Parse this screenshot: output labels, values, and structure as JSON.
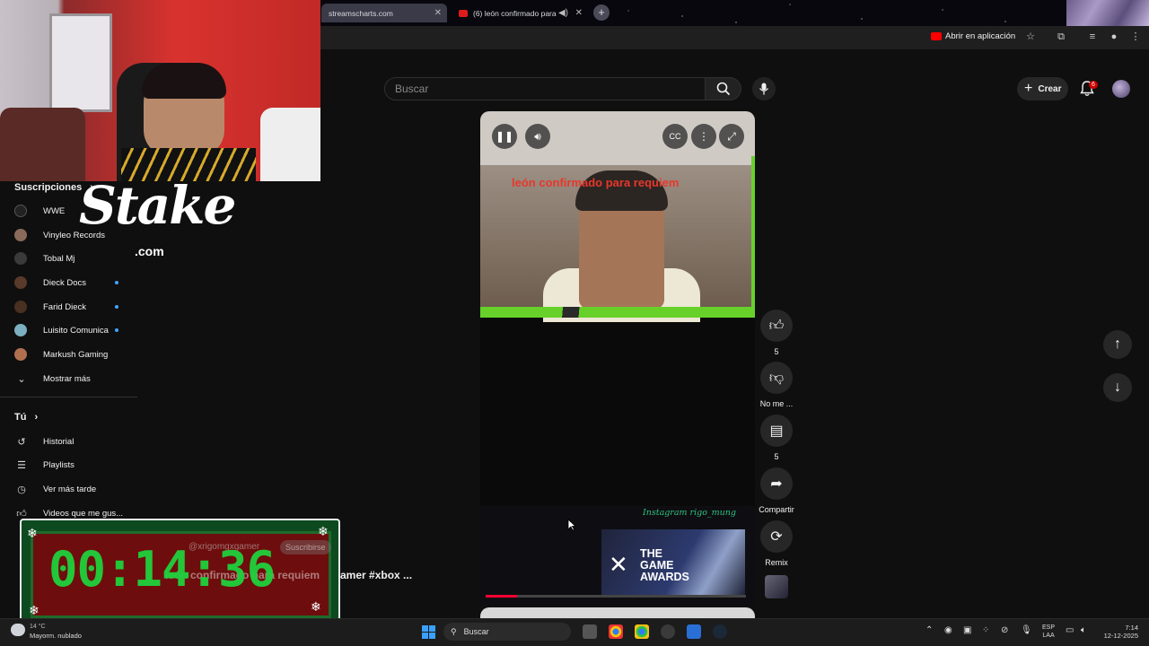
{
  "browser": {
    "tabs": [
      {
        "label": "streamscharts.com"
      },
      {
        "label": "(6) león confirmado para"
      }
    ],
    "open_in_app": "Abrir en aplicación"
  },
  "header": {
    "search_placeholder": "Buscar",
    "create_label": "Crear",
    "notification_count": "6"
  },
  "overlay": {
    "stake_logo": "Stake",
    "stake_sub": ".com"
  },
  "sidebar": {
    "subscriptions_heading": "Suscripciones",
    "subscriptions": [
      {
        "label": "WWE",
        "live": false
      },
      {
        "label": "Vinyleo Records",
        "live": false
      },
      {
        "label": "Tobal Mj",
        "live": false
      },
      {
        "label": "Dieck Docs",
        "live": true
      },
      {
        "label": "Farid Dieck",
        "live": true
      },
      {
        "label": "Luisito Comunica",
        "live": true
      },
      {
        "label": "Markush Gaming",
        "live": false
      }
    ],
    "show_more": "Mostrar más",
    "you_heading": "Tú",
    "you_items": [
      {
        "label": "Historial"
      },
      {
        "label": "Playlists"
      },
      {
        "label": "Ver más tarde"
      },
      {
        "label": "Videos que me gus..."
      }
    ]
  },
  "video": {
    "caption": "león confirmado para requiem",
    "instagram_tag": "Instagram rigo_mung",
    "game_awards_line1": "THE",
    "game_awards_line2": "GAME",
    "game_awards_line3": "AWARDS",
    "progress": 0.12
  },
  "actions": {
    "like_count": "5",
    "dislike_label": "No me ...",
    "comments_count": "5",
    "share_label": "Compartir",
    "remix_label": "Remix"
  },
  "timer": {
    "value": "00:14:36",
    "ghost_handle": "@xrigomgxgamer",
    "ghost_subscribe": "Suscribirse",
    "ghost_title": "león confirmado para requiem",
    "title_tail": "amer #xbox ..."
  },
  "taskbar": {
    "weather_temp": "14 °C",
    "weather_text": "Mayorm. nublado",
    "search_label": "Buscar",
    "lang_line1": "ESP",
    "lang_line2": "LAA",
    "time": "7:14",
    "date": "12-12-2025"
  }
}
